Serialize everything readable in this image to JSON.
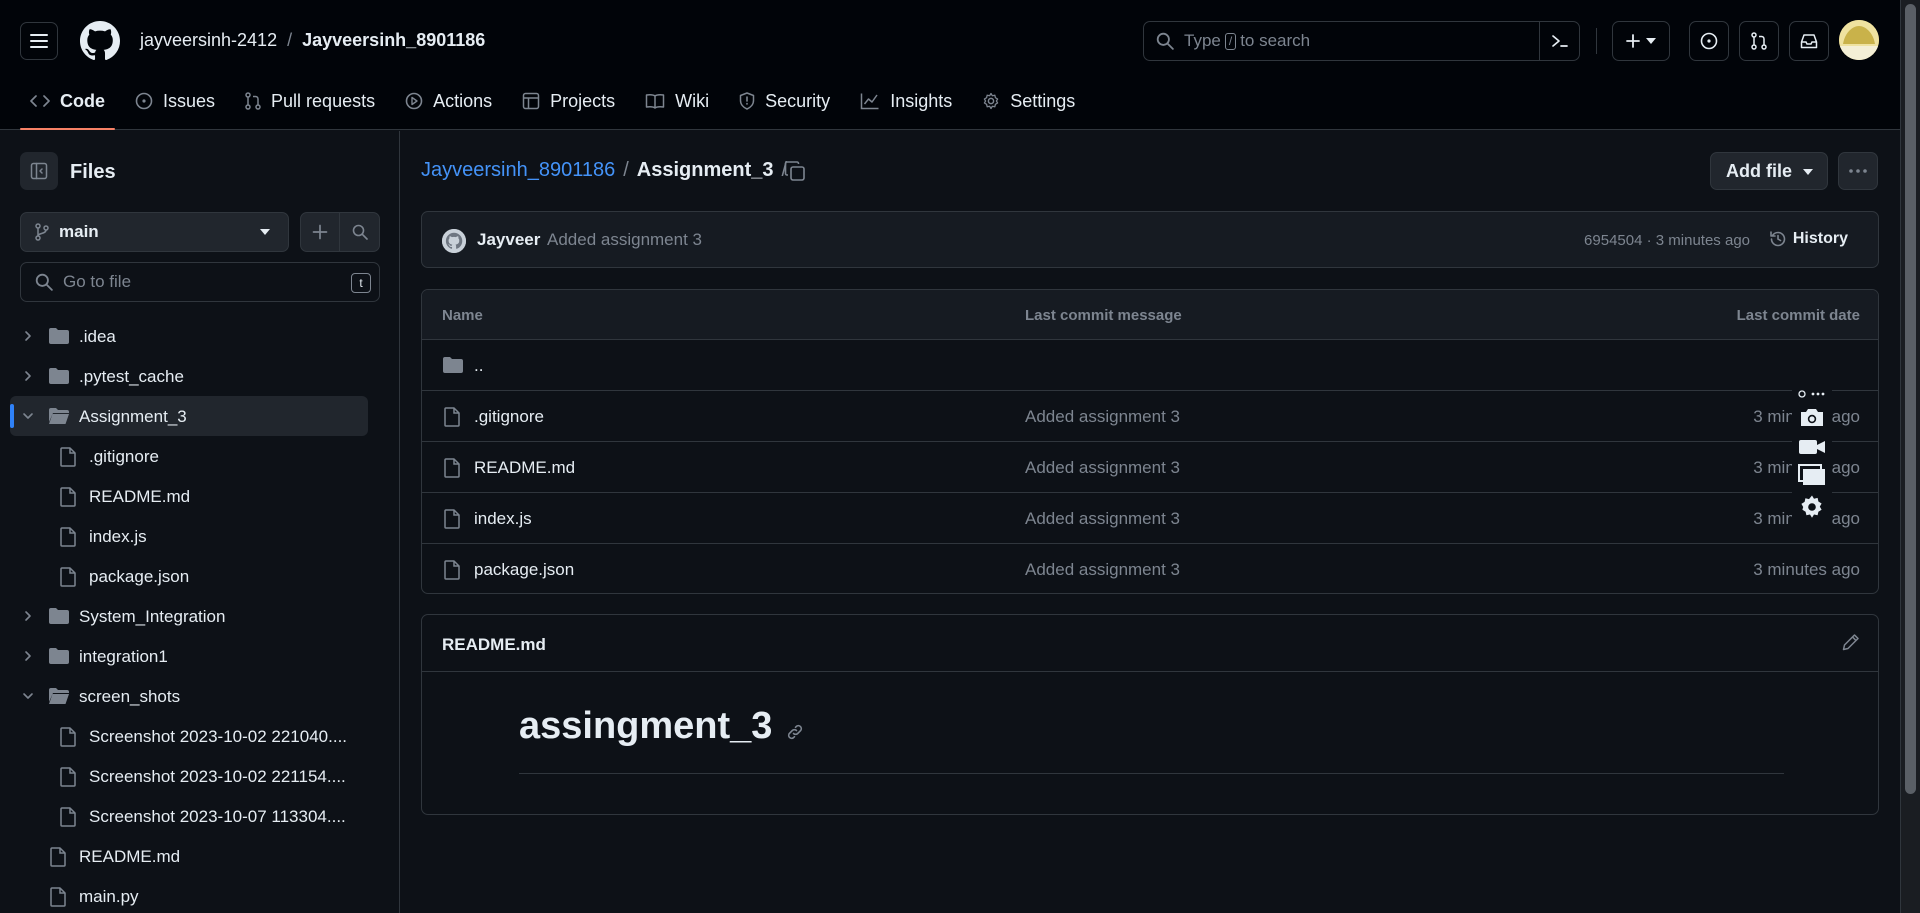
{
  "header": {
    "owner": "jayveersinh-2412",
    "separator": "/",
    "repo": "Jayveersinh_8901186",
    "search_prefix": "Type",
    "search_key": "/",
    "search_suffix": "to search"
  },
  "nav": {
    "code": "Code",
    "issues": "Issues",
    "pull_requests": "Pull requests",
    "actions": "Actions",
    "projects": "Projects",
    "wiki": "Wiki",
    "security": "Security",
    "insights": "Insights",
    "settings": "Settings"
  },
  "sidebar": {
    "title": "Files",
    "branch": "main",
    "goto_placeholder": "Go to file",
    "goto_key": "t",
    "tree": [
      {
        "label": ".idea"
      },
      {
        "label": ".pytest_cache"
      },
      {
        "label": "Assignment_3"
      },
      {
        "label": ".gitignore"
      },
      {
        "label": "README.md"
      },
      {
        "label": "index.js"
      },
      {
        "label": "package.json"
      },
      {
        "label": "System_Integration"
      },
      {
        "label": "integration1"
      },
      {
        "label": "screen_shots"
      },
      {
        "label": "Screenshot 2023-10-02 221040...."
      },
      {
        "label": "Screenshot 2023-10-02 221154...."
      },
      {
        "label": "Screenshot 2023-10-07 113304...."
      },
      {
        "label": "README.md"
      },
      {
        "label": "main.py"
      }
    ]
  },
  "breadcrumb": {
    "repo": "Jayveersinh_8901186",
    "sep": "/",
    "folder": "Assignment_3",
    "trail": "/"
  },
  "actions": {
    "add_file": "Add file"
  },
  "commit": {
    "author": "Jayveer",
    "message": "Added assignment 3",
    "meta": "6954504 · 3 minutes ago",
    "history": "History"
  },
  "table": {
    "headers": {
      "name": "Name",
      "message": "Last commit message",
      "date": "Last commit date"
    },
    "parent": "..",
    "rows": [
      {
        "name": ".gitignore",
        "message": "Added assignment 3",
        "date": "3 minutes ago"
      },
      {
        "name": "README.md",
        "message": "Added assignment 3",
        "date": "3 minutes ago"
      },
      {
        "name": "index.js",
        "message": "Added assignment 3",
        "date": "3 minutes ago"
      },
      {
        "name": "package.json",
        "message": "Added assignment 3",
        "date": "3 minutes ago"
      }
    ]
  },
  "readme": {
    "title": "README.md",
    "heading": "assingment_3"
  },
  "colors": {
    "accent_link": "#4493f8",
    "active_tab": "#f78166",
    "background": "#0d1117",
    "border": "#30363d"
  }
}
